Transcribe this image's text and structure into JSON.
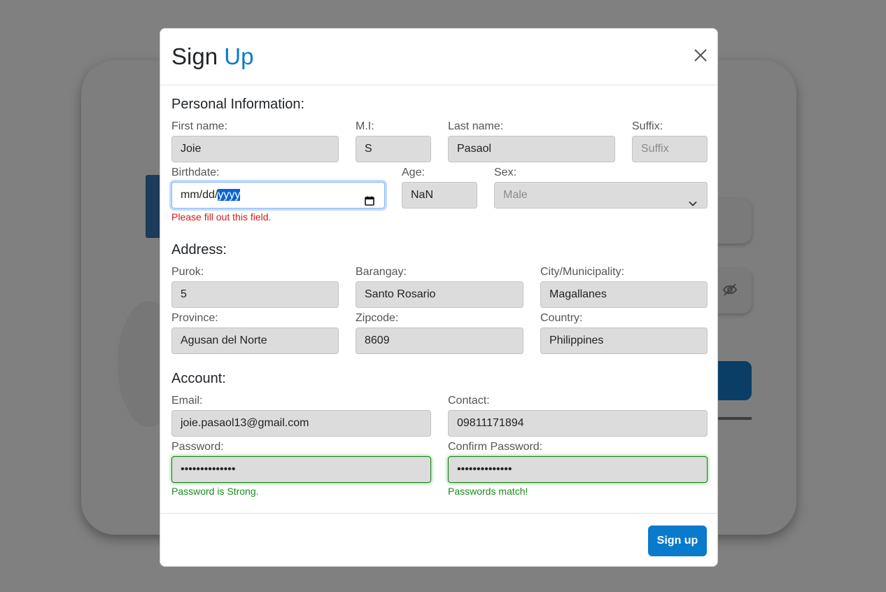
{
  "modal": {
    "title_main": "Sign",
    "title_accent": "Up"
  },
  "personal": {
    "heading": "Personal Information:",
    "first_name_label": "First name:",
    "first_name_value": "Joie",
    "mi_label": "M.I:",
    "mi_value": "S",
    "last_name_label": "Last name:",
    "last_name_value": "Pasaol",
    "suffix_label": "Suffix:",
    "suffix_placeholder": "Suffix",
    "birthdate_label": "Birthdate:",
    "birthdate_prefix": "mm/dd/",
    "birthdate_selected": "yyyy",
    "birthdate_error": "Please fill out this field.",
    "age_label": "Age:",
    "age_value": "NaN",
    "sex_label": "Sex:",
    "sex_selected": "Male"
  },
  "address": {
    "heading": "Address:",
    "purok_label": "Purok:",
    "purok_value": "5",
    "barangay_label": "Barangay:",
    "barangay_value": "Santo Rosario",
    "city_label": "City/Municipality:",
    "city_value": "Magallanes",
    "province_label": "Province:",
    "province_value": "Agusan del Norte",
    "zipcode_label": "Zipcode:",
    "zipcode_value": "8609",
    "country_label": "Country:",
    "country_value": "Philippines"
  },
  "account": {
    "heading": "Account:",
    "email_label": "Email:",
    "email_value": "joie.pasaol13@gmail.com",
    "contact_label": "Contact:",
    "contact_value": "09811171894",
    "password_label": "Password:",
    "password_masked": "••••••••••••••",
    "password_status": "Password is Strong.",
    "confirm_label": "Confirm Password:",
    "confirm_masked": "••••••••••••••",
    "confirm_status": "Passwords match!"
  },
  "footer": {
    "signup_label": "Sign up"
  },
  "colors": {
    "accent": "#0a7acc",
    "error": "#d11a1a",
    "success": "#1a8a1a",
    "overlay": "#808080"
  },
  "icons": [
    "close-icon",
    "calendar-icon",
    "chevron-down-icon",
    "eye-slash-icon"
  ]
}
